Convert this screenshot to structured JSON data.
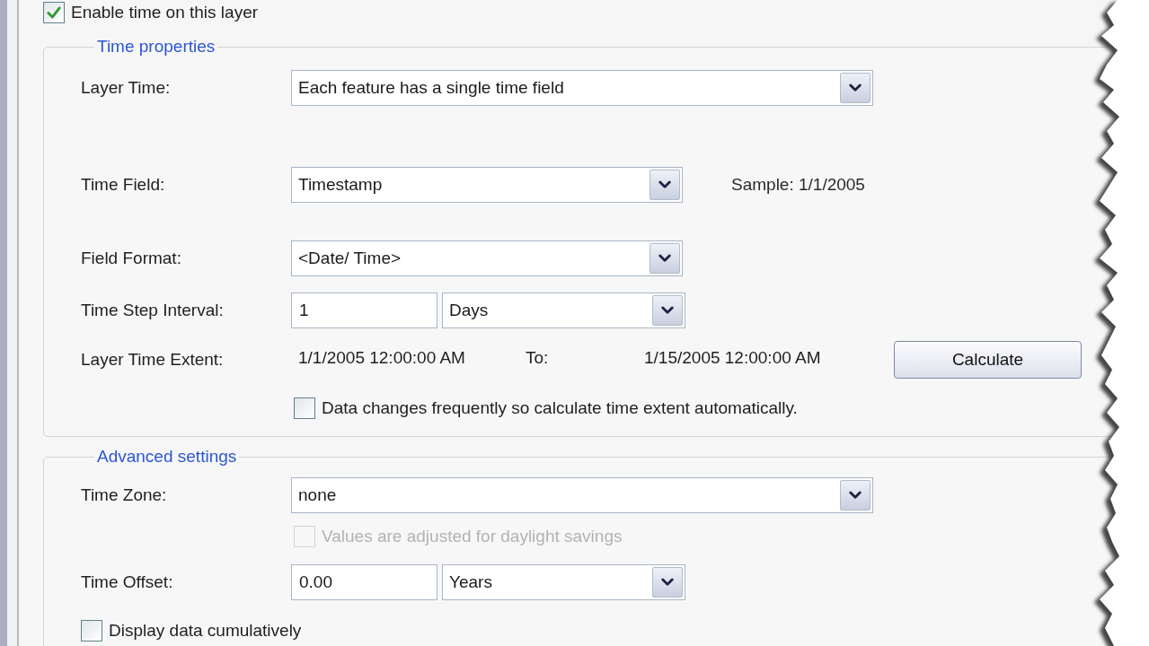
{
  "enable_time": {
    "label": "Enable time on this layer",
    "checked": true
  },
  "groups": [
    {
      "title": "Time properties",
      "rows": [
        {
          "kind": "wide_select",
          "label": "Layer Time:",
          "value": "Each feature has a single time field"
        },
        {
          "kind": "select",
          "label": "Time Field:",
          "value": "Timestamp",
          "note": "Sample: 1/1/2005"
        },
        {
          "kind": "select",
          "label": "Field Format:",
          "value": "<Date/ Time>"
        },
        {
          "kind": "number_unit",
          "label": "Time Step Interval:",
          "value": "1",
          "unit": "Days"
        },
        {
          "kind": "extent",
          "label": "Layer Time Extent:",
          "from": "1/1/2005 12:00:00 AM",
          "to_label": "To:",
          "to": "1/15/2005 12:00:00 AM",
          "button": "Calculate"
        },
        {
          "kind": "option",
          "label": "Data changes frequently so calculate time extent automatically.",
          "checked": false,
          "disabled": false
        }
      ]
    },
    {
      "title": "Advanced settings",
      "rows": [
        {
          "kind": "wide_select",
          "label": "Time Zone:",
          "value": "none"
        },
        {
          "kind": "option",
          "label": "Values are adjusted for daylight savings",
          "checked": false,
          "disabled": true
        },
        {
          "kind": "number_unit",
          "label": "Time Offset:",
          "value": "0.00",
          "unit": "Years"
        },
        {
          "kind": "checkbox",
          "label": "Display data cumulatively",
          "checked": false,
          "disabled": false
        }
      ]
    }
  ]
}
